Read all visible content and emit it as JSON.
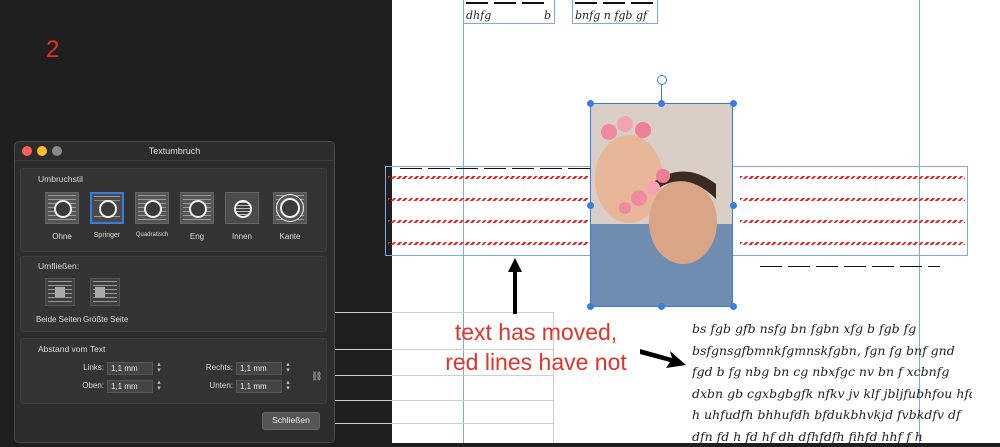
{
  "step_number": "2",
  "top_fragments": [
    "dhfg",
    "b",
    "bnfg n fgb gf"
  ],
  "body_text": [
    "bs fgb gfb nsfg bn fgbn xfg b fgb fg",
    "bsfgnsgfbmnkfgmnskfgbn, fgn fg bnf gnd",
    "fgd b fg nbg bn cg nbxfgc nv bn f xcbnfg",
    "dxbn gb cgxbgbgfk nfkv jv klf jbljfubhfou hfd",
    "h uhfudfh bhhufdh bfdukbhvkjd fvbkdfv df",
    "dfn fd h fd hf dh dfhfdfh fihfd hhf f h"
  ],
  "annotation": {
    "line1": "text has moved,",
    "line2": "red lines have not"
  },
  "dialog": {
    "title": "Textumbruch",
    "section_wrap": "Umbruchstil",
    "wrap_styles": [
      "Ohne",
      "Springer",
      "Quadratisch",
      "Eng",
      "Innen",
      "Kante"
    ],
    "selected_style": "Springer",
    "section_flow": "Umfließen:",
    "flow_options": [
      "Beide Seiten",
      "Größte Seite"
    ],
    "section_distance": "Abstand vom Text",
    "fields": {
      "links": {
        "label": "Links:",
        "value": "1,1 mm"
      },
      "oben": {
        "label": "Oben:",
        "value": "1,1 mm"
      },
      "rechts": {
        "label": "Rechts:",
        "value": "1,1 mm"
      },
      "unten": {
        "label": "Unten:",
        "value": "1,1 mm"
      }
    },
    "close_label": "Schließen"
  },
  "colors": {
    "annotation_red": "#e0342b",
    "selection_blue": "#3b7ae0",
    "dialog_bg": "#2c2c2c"
  }
}
